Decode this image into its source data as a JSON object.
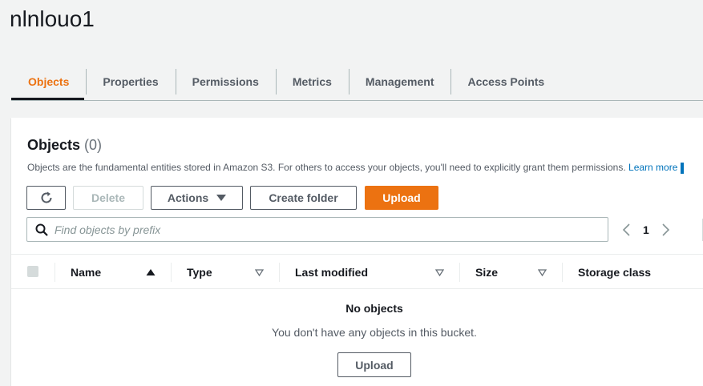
{
  "bucket": {
    "name": "nlnlouo1"
  },
  "tabs": [
    {
      "label": "Objects",
      "active": true
    },
    {
      "label": "Properties"
    },
    {
      "label": "Permissions"
    },
    {
      "label": "Metrics"
    },
    {
      "label": "Management"
    },
    {
      "label": "Access Points"
    }
  ],
  "objects_panel": {
    "title": "Objects",
    "count": "(0)",
    "description": "Objects are the fundamental entities stored in Amazon S3. For others to access your objects, you'll need to explicitly grant them permissions.",
    "learn_more": "Learn more"
  },
  "toolbar": {
    "refresh_icon": "refresh-icon",
    "delete_label": "Delete",
    "actions_label": "Actions",
    "create_folder_label": "Create folder",
    "upload_label": "Upload"
  },
  "search": {
    "placeholder": "Find objects by prefix",
    "value": ""
  },
  "pagination": {
    "current_page": "1"
  },
  "table": {
    "columns": [
      {
        "label": "Name",
        "sort": "ascending"
      },
      {
        "label": "Type",
        "sort": "none"
      },
      {
        "label": "Last modified",
        "sort": "none"
      },
      {
        "label": "Size",
        "sort": "none"
      },
      {
        "label": "Storage class",
        "sort": "none"
      }
    ]
  },
  "empty_state": {
    "title": "No objects",
    "description": "You don't have any objects in this bucket.",
    "upload_label": "Upload"
  },
  "colors": {
    "accent": "#ec7211",
    "link": "#0073bb",
    "text": "#16191f",
    "muted": "#545b64"
  }
}
